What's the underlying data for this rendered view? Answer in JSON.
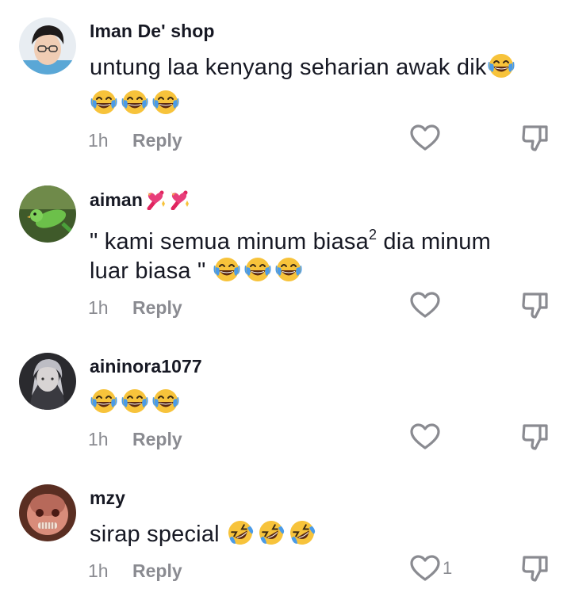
{
  "comments": [
    {
      "username": "Iman De' shop",
      "text_line1": "untung laa kenyang seharian awak dik",
      "text_line2": "",
      "emoji_icon": "face-with-tears-of-joy",
      "time": "1h",
      "reply_label": "Reply",
      "like_count": ""
    },
    {
      "username": "aiman",
      "username_icon": "sparkling-heart-emoji",
      "text_line1a": "\" kami semua minum biasa",
      "text_superscript": "2",
      "text_line1b": " dia minum",
      "text_line2": "luar biasa \" ",
      "emoji_icon": "face-with-tears-of-joy",
      "time": "1h",
      "reply_label": "Reply",
      "like_count": ""
    },
    {
      "username": "aininora1077",
      "text_line1": "",
      "emoji_icon": "face-with-tears-of-joy",
      "time": "1h",
      "reply_label": "Reply",
      "like_count": ""
    },
    {
      "username": "mzy",
      "text_line1": "sirap special ",
      "emoji_icon": "rolling-on-floor-laughing",
      "time": "1h",
      "reply_label": "Reply",
      "like_count": "1"
    }
  ],
  "icons": {
    "like": "heart-outline-icon",
    "dislike": "thumbs-down-outline-icon"
  },
  "colors": {
    "text": "#161823",
    "muted": "#8a8b91",
    "emoji_face": "#F7C33B",
    "emoji_tears": "#4A9BE8"
  }
}
